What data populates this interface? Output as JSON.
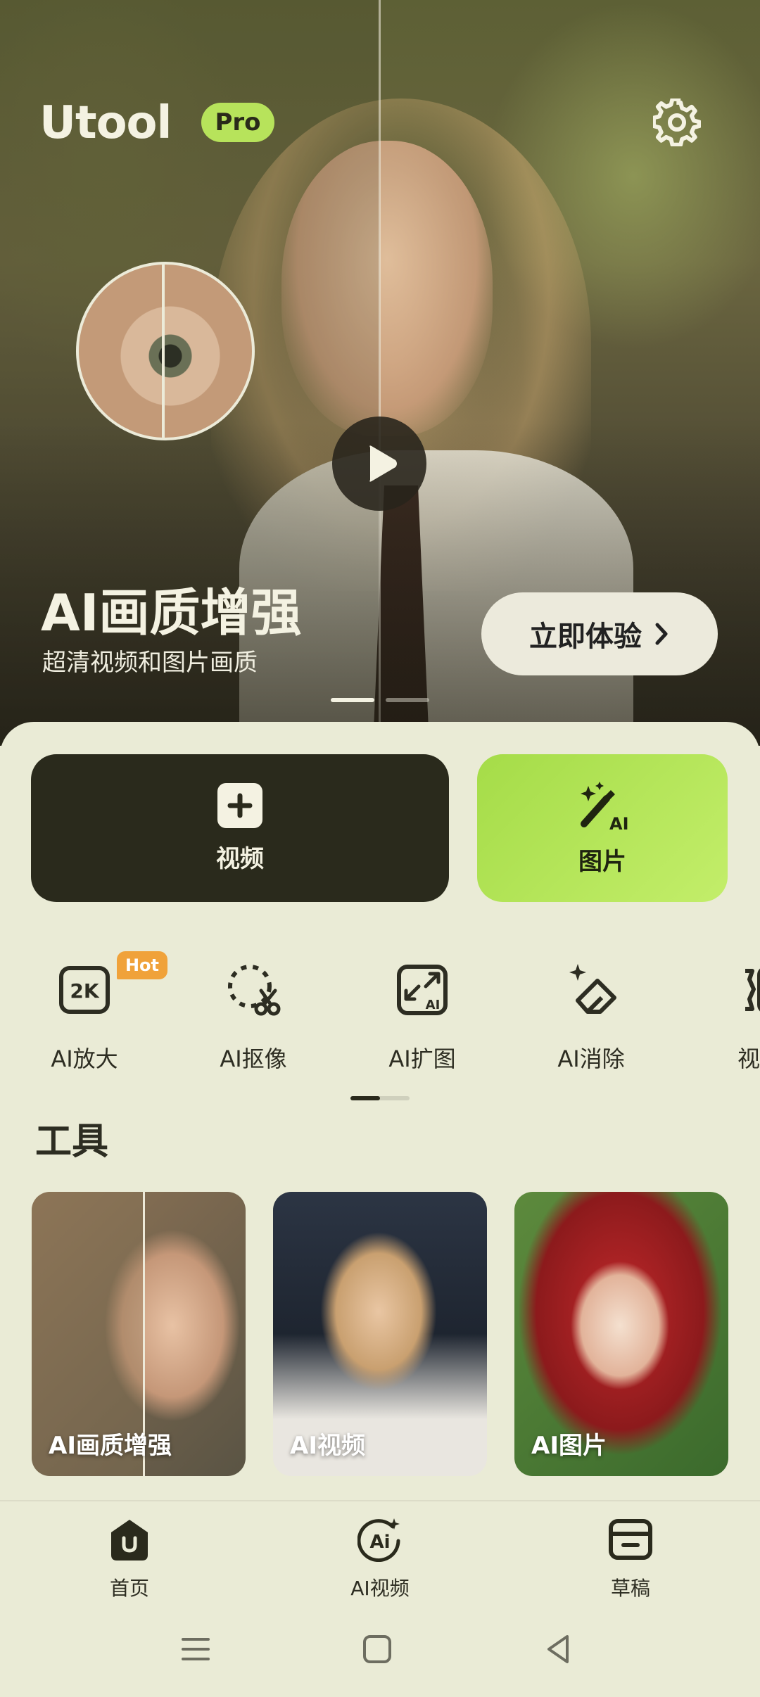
{
  "app": {
    "logo_text": "Utool",
    "pro_badge": "Pro"
  },
  "hero": {
    "title": "AI画质增强",
    "subtitle": "超清视频和图片画质",
    "cta_label": "立即体验",
    "carousel": {
      "pages": 2,
      "active": 1
    }
  },
  "main_actions": {
    "video_label": "视频",
    "image_label": "图片",
    "image_icon_text": "AI"
  },
  "quick_tools": [
    {
      "label": "AI放大",
      "icon": "2k-upscale-icon",
      "icon_text": "2K",
      "badge": "Hot"
    },
    {
      "label": "AI抠像",
      "icon": "cutout-scissors-icon"
    },
    {
      "label": "AI扩图",
      "icon": "expand-image-icon",
      "icon_text": "AI"
    },
    {
      "label": "AI消除",
      "icon": "eraser-icon"
    },
    {
      "label": "视频",
      "icon": "video-tool-icon"
    }
  ],
  "tools_section": {
    "title": "工具",
    "cards": [
      {
        "label": "AI画质增强"
      },
      {
        "label": "AI视频"
      },
      {
        "label": "AI图片"
      }
    ]
  },
  "bottom_nav": [
    {
      "label": "首页",
      "icon": "home-icon",
      "active": true
    },
    {
      "label": "AI视频",
      "icon": "ai-video-icon",
      "icon_text": "Ai"
    },
    {
      "label": "草稿",
      "icon": "drafts-icon"
    }
  ],
  "colors": {
    "accent": "#b7e35b",
    "dark": "#2a2a1c",
    "background": "#eaebd6",
    "hot": "#f0a23a"
  }
}
